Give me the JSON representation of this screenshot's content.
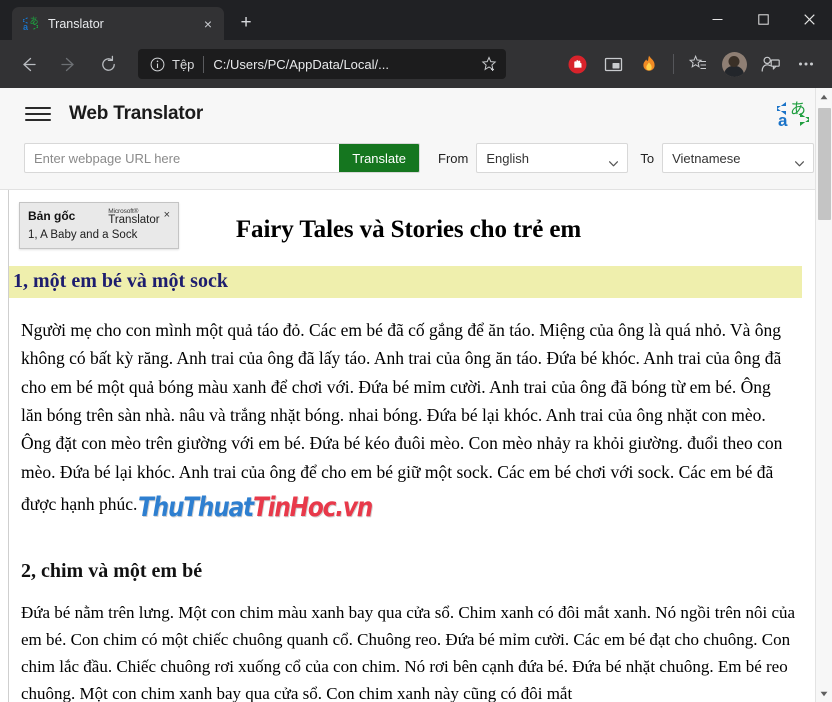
{
  "browser": {
    "tab": {
      "title": "Translator",
      "favicon": "translator-logo-icon",
      "close_label": "×"
    },
    "new_tab_label": "+",
    "window_controls": {
      "minimize": "minimize-icon",
      "maximize": "maximize-icon",
      "close": "close-icon"
    },
    "nav": {
      "back": "back-arrow-icon",
      "forward": "forward-arrow-icon",
      "refresh": "refresh-icon"
    },
    "address_bar": {
      "info_icon": "info-circle-icon",
      "scheme_label": "Tệp",
      "url": "C:/Users/PC/AppData/Local/...",
      "favorite_icon": "star-add-icon"
    },
    "toolbar_icons": [
      "adblock-icon",
      "picture-in-picture-icon",
      "extension-fire-icon",
      "favorites-icon",
      "profile-avatar",
      "collections-icon",
      "settings-more-icon"
    ]
  },
  "translator": {
    "menu_icon": "hamburger-menu-icon",
    "app_title": "Web Translator",
    "brand_logo": "microsoft-translator-logo-icon",
    "url_input": {
      "value": "",
      "placeholder": "Enter webpage URL here"
    },
    "translate_button": "Translate",
    "from_label": "From",
    "from_value": "English",
    "to_label": "To",
    "to_value": "Vietnamese",
    "chevron_icon": "chevron-down-icon",
    "accent_green": "#15761f"
  },
  "original_popup": {
    "label": "Bản gốc",
    "brand_ms": "Microsoft®",
    "brand_name": "Translator",
    "close_label": "×",
    "original_text": "1, A Baby and a Sock"
  },
  "document": {
    "title": "Fairy Tales và Stories cho trẻ em",
    "section1": {
      "heading": "1, một em bé và một sock",
      "highlight_color": "#efefad",
      "heading_color": "#1d1d6e",
      "paragraph": "Người mẹ cho con mình một quả táo đỏ. Các em bé đã cố gắng để ăn táo. Miệng của ông là quá nhỏ. Và ông không có bất kỳ răng. Anh trai của ông đã lấy táo. Anh trai của ông ăn táo. Đứa bé khóc. Anh trai của ông đã cho em bé một quả bóng màu xanh để chơi với. Đứa bé mỉm cười. Anh trai của ông đã bóng từ em bé. Ông lăn bóng trên sàn nhà. nâu và trắng nhặt bóng. nhai bóng. Đứa bé lại khóc. Anh trai của ông nhặt con mèo. Ông đặt con mèo trên giường với em bé. Đứa bé kéo đuôi mèo. Con mèo nhảy ra khỏi giường. đuổi theo con mèo. Đứa bé lại khóc. Anh trai của ông để cho em bé giữ một sock. Các em bé chơi với sock. Các em bé đã được hạnh phúc."
    },
    "section2": {
      "heading": "2, chim và một em bé",
      "paragraph": "Đứa bé nằm trên lưng. Một con chim màu xanh bay qua cửa sổ. Chim xanh có đôi mắt xanh. Nó ngồi trên nôi của em bé. Con chim có một chiếc chuông quanh cổ. Chuông reo. Đứa bé mỉm cười. Các em bé đạt cho chuông. Con chim lắc đầu. Chiếc chuông rơi xuống cổ của con chim. Nó rơi bên cạnh đứa bé. Đứa bé nhặt chuông. Em bé reo chuông. Một con chim xanh bay qua cửa sổ. Con chim xanh này cũng có đôi mắt"
    },
    "watermark": {
      "part1": "ThuThuat",
      "part2": "TinHoc.vn",
      "color1": "#2e7fd0",
      "color2": "#e8394a"
    }
  },
  "scrollbar": {
    "up_arrow": "scroll-up-icon",
    "down_arrow": "scroll-down-icon"
  }
}
